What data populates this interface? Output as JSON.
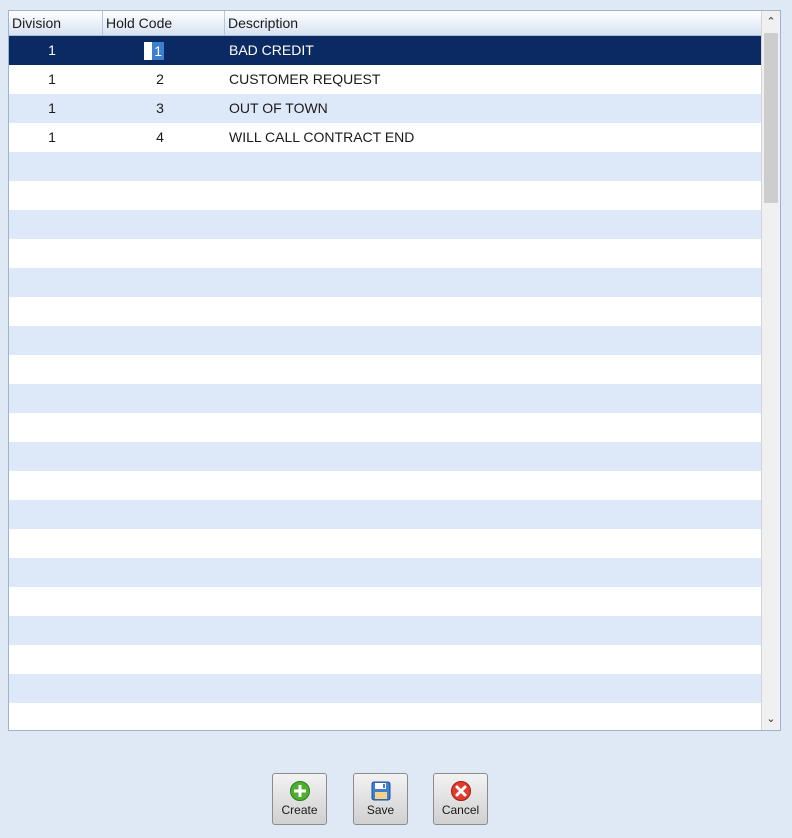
{
  "grid": {
    "columns": [
      {
        "label": "Division"
      },
      {
        "label": "Hold Code"
      },
      {
        "label": "Description"
      }
    ],
    "rows": [
      {
        "division": "1",
        "hold_code": "1",
        "description": "BAD CREDIT"
      },
      {
        "division": "1",
        "hold_code": "2",
        "description": "CUSTOMER REQUEST"
      },
      {
        "division": "1",
        "hold_code": "3",
        "description": "OUT OF TOWN"
      },
      {
        "division": "1",
        "hold_code": "4",
        "description": "WILL CALL CONTRACT END"
      }
    ],
    "selected_row": 0
  },
  "toolbar": {
    "create_label": "Create",
    "save_label": "Save",
    "cancel_label": "Cancel"
  },
  "icons": {
    "scroll_up": "chevron-up-icon",
    "scroll_down": "chevron-down-icon",
    "create": "plus-circle-icon",
    "save": "save-icon",
    "cancel": "cancel-circle-icon"
  },
  "colors": {
    "selected_row": "#0b2a63",
    "alt_row": "#dde9f8",
    "background": "#dfe9f5"
  }
}
